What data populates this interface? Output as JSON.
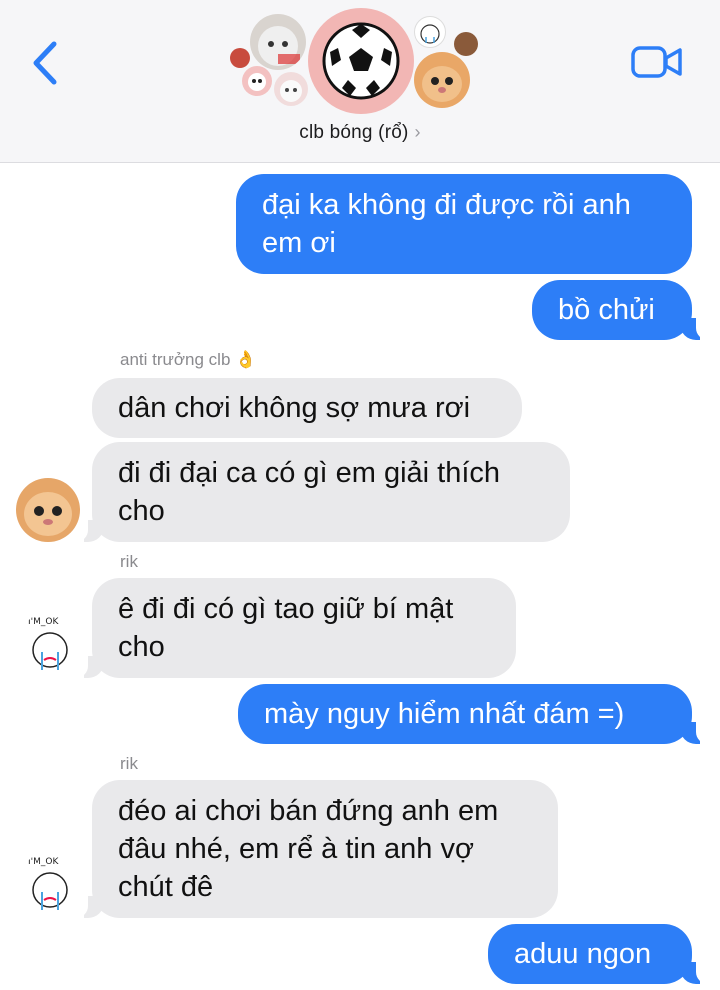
{
  "header": {
    "group_name": "clb bóng (rổ)",
    "chevron": "›",
    "back_icon": "chevron-left-icon",
    "video_icon": "video-camera-icon",
    "accent": "#2d7ef7"
  },
  "messages": [
    {
      "direction": "outgoing",
      "text": "đại ka không đi được rồi anh em ơi"
    },
    {
      "direction": "outgoing",
      "text": "bồ chửi"
    },
    {
      "direction": "incoming",
      "sender": "anti trưởng clb",
      "sender_emoji": "👌",
      "text": "dân chơi không sợ mưa rơi"
    },
    {
      "direction": "incoming",
      "text": "đi đi đại ca có gì em giải thích cho"
    },
    {
      "direction": "incoming",
      "sender": "rik",
      "text": "ê đi đi có gì tao giữ bí mật cho"
    },
    {
      "direction": "outgoing",
      "text": "mày nguy hiểm nhất đám =)"
    },
    {
      "direction": "incoming",
      "sender": "rik",
      "text": "đéo ai chơi bán đứng anh em đâu nhé, em rể à tin anh vợ chút đê"
    },
    {
      "direction": "outgoing",
      "text": "aduu ngon"
    }
  ],
  "avatar_labels": {
    "im_ok": "I'M_OK"
  }
}
